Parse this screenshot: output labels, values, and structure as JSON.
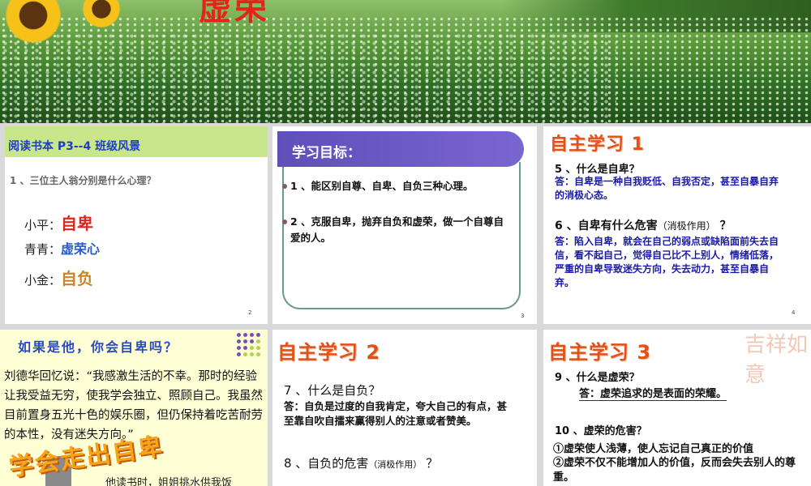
{
  "banner": {
    "title": "虚荣"
  },
  "slide1": {
    "header": "阅读书本 P3--4   班级风景",
    "question": "1 、三位主人翁分别是什么心理？",
    "people": [
      {
        "name": "小平：",
        "trait": "自卑",
        "color": "#e0251b"
      },
      {
        "name": "青青：",
        "trait": "虚荣心",
        "color": "#2a5bd0"
      },
      {
        "name": "小金：",
        "trait": "自负",
        "color": "#c8862a"
      }
    ],
    "page": "2"
  },
  "slide2": {
    "header": "学习目标：",
    "items": [
      "1 、能区别自尊、自卑、自负三种心理。",
      "2 、克服自卑，抛弃自负和虚荣，做一个自尊自爱的人。"
    ],
    "page": "3"
  },
  "slide3": {
    "title": "自主学习 1",
    "q5": "5 、什么是自卑？",
    "a5": "答：自卑是一种自我贬低、自我否定，甚至自暴自弃的消极心态。",
    "q6": "6 、自卑有什么危害",
    "q6_note": "（消极作用）",
    "q6_mark": "？",
    "a6": "答：陷入自卑，就会在自己的弱点或缺陷面前失去自信，看不起自己，觉得自己比不上别人，情绪低落，严重的自卑导致迷失方向，失去动力，甚至自暴自弃。",
    "page": "4"
  },
  "slide4": {
    "header": "如果是他，你会自卑吗？",
    "body": "刘德华回忆说：“我感激生活的不幸。那时的经验让我受益无穷，使我学会独立、照顾自己。我虽然目前置身五光十色的娱乐圈，但仍保持着吃苦耐劳的本性，没有迷失方向。”",
    "overlay": "学会走出自卑",
    "bottom": "他读书时，姐姐挑水供我饭"
  },
  "slide5": {
    "title": "自主学习 2",
    "q7": "7 、什么是自负？",
    "a7": "答：自负是过度的自我肯定，夸大自己的有点，甚至靠自吹自擂来赢得别人的注意或者赞美。",
    "q8": "8 、自负的危害",
    "q8_note": "（消极作用）",
    "q8_mark": "？"
  },
  "slide6": {
    "title": "自主学习 3",
    "watermark": "吉祥如意",
    "q9": "9 、什么是虚荣？",
    "a9": "答：虚荣追求的是表面的荣耀。",
    "q10": "10 、虚荣的危害？",
    "a10_1": "①虚荣使人浅薄，使人忘记自己真正的价值",
    "a10_2": "②虚荣不仅不能增加人的价值，反而会失去别人的尊重。"
  },
  "colors": {
    "accent_red": "#e2501b",
    "answer_blue": "#1a1aa8",
    "header_purple": "#6a58c4",
    "leaf_green": "#c9e78a"
  }
}
